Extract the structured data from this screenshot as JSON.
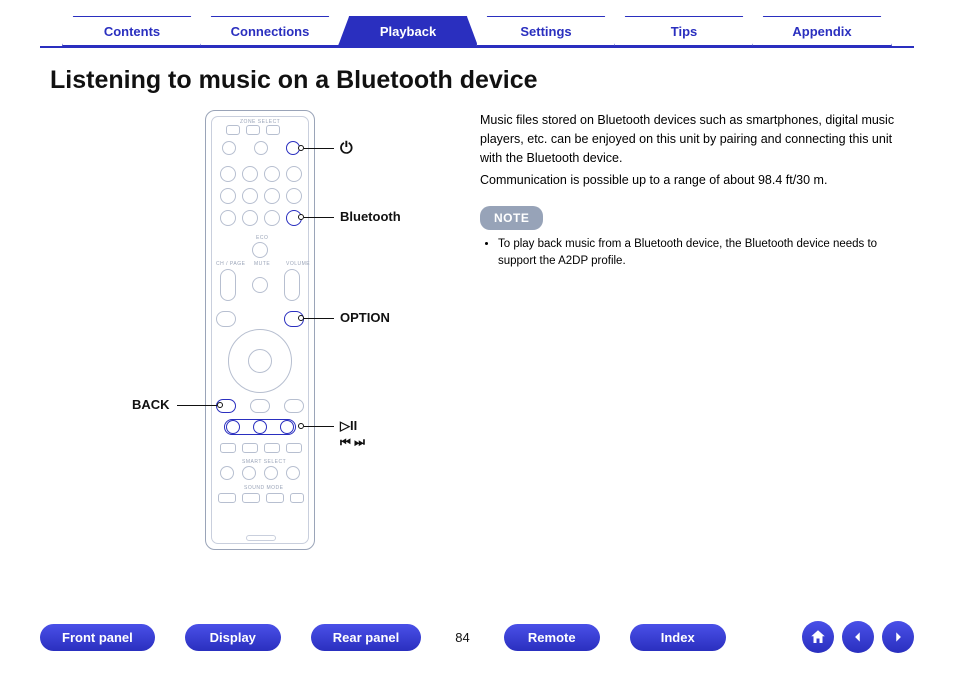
{
  "tabs": [
    {
      "label": "Contents",
      "active": false
    },
    {
      "label": "Connections",
      "active": false
    },
    {
      "label": "Playback",
      "active": true
    },
    {
      "label": "Settings",
      "active": false
    },
    {
      "label": "Tips",
      "active": false
    },
    {
      "label": "Appendix",
      "active": false
    }
  ],
  "title": "Listening to music on a Bluetooth device",
  "callouts": {
    "power": "⏻",
    "bluetooth": "Bluetooth",
    "option": "OPTION",
    "back": "BACK",
    "playpause": "▷II",
    "skip": "⏮ ⏭"
  },
  "body": {
    "p1": "Music files stored on Bluetooth devices such as smartphones, digital music players, etc. can be enjoyed on this unit by pairing and connecting this unit with the Bluetooth device.",
    "p2": "Communication is possible up to a range of about 98.4 ft/30 m."
  },
  "note": {
    "label": "NOTE",
    "items": [
      "To play back music from a Bluetooth device, the Bluetooth device needs to support the A2DP profile."
    ]
  },
  "footer": {
    "links": [
      "Front panel",
      "Display",
      "Rear panel",
      "Remote",
      "Index"
    ],
    "page": "84"
  },
  "nav_icons": {
    "home": "home-icon",
    "prev": "arrow-left-icon",
    "next": "arrow-right-icon"
  }
}
